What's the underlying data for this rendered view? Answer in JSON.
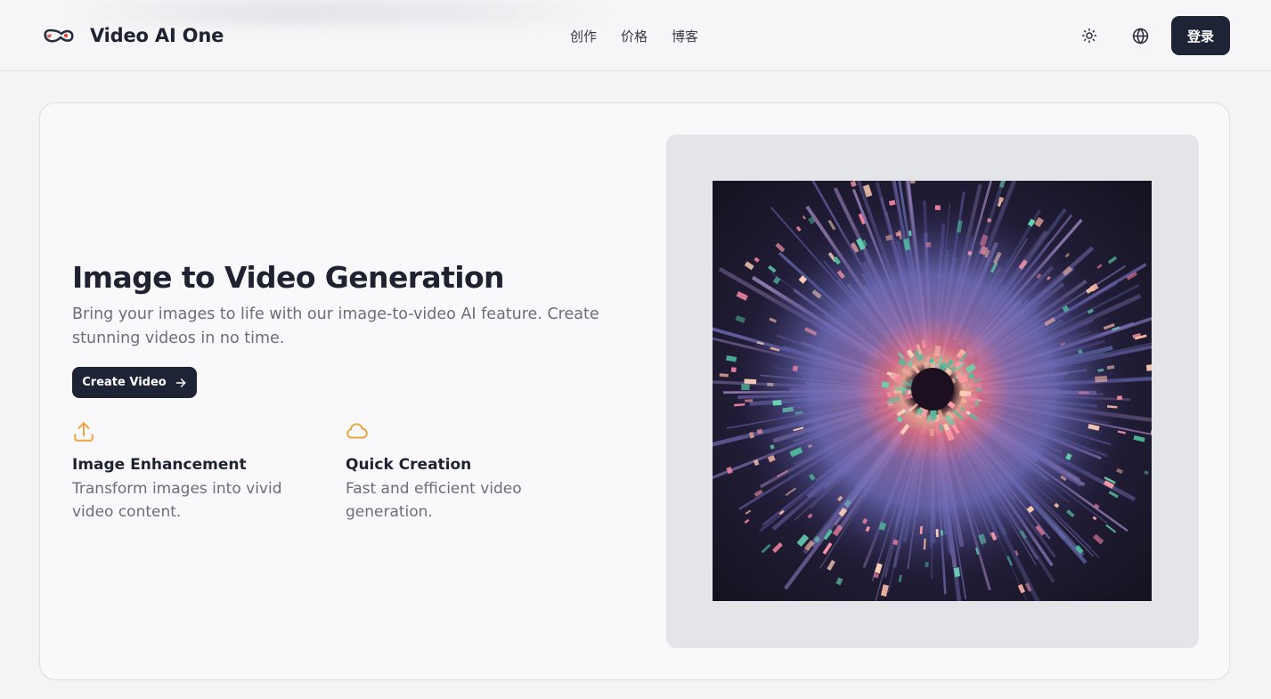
{
  "header": {
    "brand_name": "Video AI One",
    "nav": [
      {
        "label": "创作"
      },
      {
        "label": "价格"
      },
      {
        "label": "博客"
      }
    ],
    "theme_icon": "sun-icon",
    "language_icon": "globe-icon",
    "login_label": "登录"
  },
  "hero": {
    "title": "Image to Video Generation",
    "subtitle": "Bring your images to life with our image-to-video AI feature. Create stunning videos in no time.",
    "cta_label": "Create Video",
    "cta_icon": "arrow-right-icon",
    "features": [
      {
        "icon": "upload-icon",
        "title": "Image Enhancement",
        "description": "Transform images into vivid video content."
      },
      {
        "icon": "cloud-icon",
        "title": "Quick Creation",
        "description": "Fast and efficient video generation."
      }
    ]
  },
  "colors": {
    "primary_dark": "#1e2435",
    "accent_orange": "#f0a23c",
    "muted_text": "#6b6e78"
  }
}
